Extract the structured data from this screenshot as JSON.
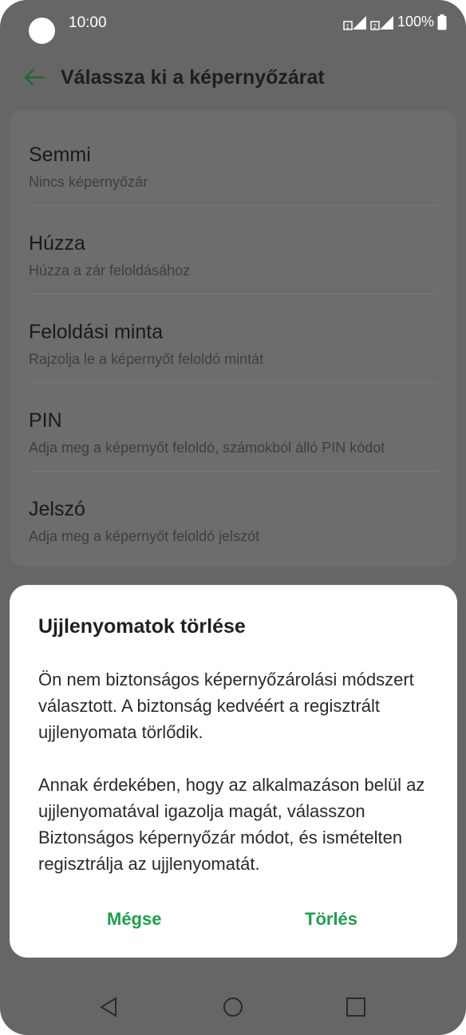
{
  "status_bar": {
    "time": "10:00",
    "battery": "100%",
    "icons": [
      "signal-sim1-icon",
      "signal-sim2-icon",
      "battery-icon"
    ]
  },
  "header": {
    "back_icon": "arrow-left-icon",
    "title": "Válassza ki a képernyőzárat"
  },
  "options": [
    {
      "title": "Semmi",
      "subtitle": "Nincs képernyőzár"
    },
    {
      "title": "Húzza",
      "subtitle": "Húzza a zár feloldásához"
    },
    {
      "title": "Feloldási minta",
      "subtitle": "Rajzolja le a képernyőt feloldó mintát"
    },
    {
      "title": "PIN",
      "subtitle": "Adja meg a képernyőt feloldó, számokból álló PIN kódot"
    },
    {
      "title": "Jelszó",
      "subtitle": "Adja meg a képernyőt feloldó jelszót"
    }
  ],
  "dialog": {
    "title": "Ujjlenyomatok törlése",
    "paragraph1": "Ön nem biztonságos képernyőzárolási módszert választott. A biztonság kedvéért a regisztrált ujjlenyomata törlődik.",
    "paragraph2": "Annak érdekében, hogy az alkalmazáson belül az ujjlenyomatával igazolja magát, válasszon Biztonságos képernyőzár módot, és ismételten regisztrálja az ujjlenyomatát.",
    "cancel_label": "Mégse",
    "delete_label": "Törlés"
  },
  "nav_bar": {
    "icons": [
      "nav-back-icon",
      "nav-home-icon",
      "nav-recents-icon"
    ]
  },
  "colors": {
    "accent": "#1aa34a",
    "dim_background": "#666666",
    "dialog_background": "#ffffff"
  }
}
